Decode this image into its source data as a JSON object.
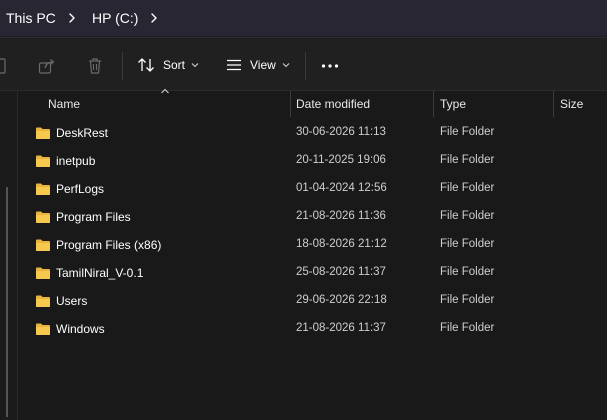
{
  "breadcrumb": {
    "items": [
      "This PC",
      "HP (C:)"
    ]
  },
  "toolbar": {
    "sort_label": "Sort",
    "view_label": "View"
  },
  "columns": {
    "name": "Name",
    "date": "Date modified",
    "type": "Type",
    "size": "Size"
  },
  "files": [
    {
      "name": "DeskRest",
      "date": "30-06-2026 11:13",
      "type": "File Folder"
    },
    {
      "name": "inetpub",
      "date": "20-11-2025 19:06",
      "type": "File Folder"
    },
    {
      "name": "PerfLogs",
      "date": "01-04-2024 12:56",
      "type": "File Folder"
    },
    {
      "name": "Program Files",
      "date": "21-08-2026 11:36",
      "type": "File Folder"
    },
    {
      "name": "Program Files (x86)",
      "date": "18-08-2026 21:12",
      "type": "File Folder"
    },
    {
      "name": "TamilNiral_V-0.1",
      "date": "25-08-2026 11:37",
      "type": "File Folder"
    },
    {
      "name": "Users",
      "date": "29-06-2026 22:18",
      "type": "File Folder"
    },
    {
      "name": "Windows",
      "date": "21-08-2026 11:37",
      "type": "File Folder"
    }
  ],
  "icons": {
    "folder": "folder-icon",
    "chevron": "chevron-right-icon",
    "sort": "sort-icon",
    "view": "view-icon",
    "more": "more-options-icon",
    "share": "share-icon",
    "delete": "delete-icon"
  },
  "colors": {
    "folder": "#e8b53d",
    "accent": "#292633"
  }
}
